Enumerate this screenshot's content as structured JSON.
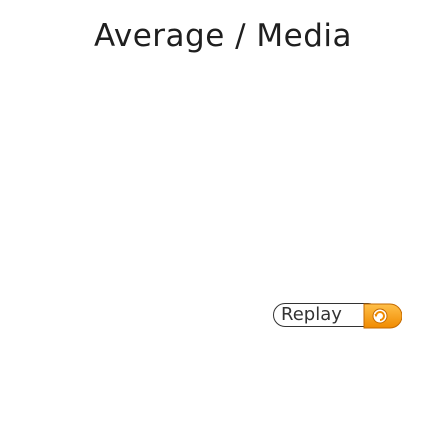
{
  "header": {
    "title": "Average / Media"
  },
  "controls": {
    "replay_label": "Replay",
    "replay_icon": "replay-arrow-icon",
    "accent_color": "#f5a623",
    "accent_color_dark": "#e08a00"
  }
}
